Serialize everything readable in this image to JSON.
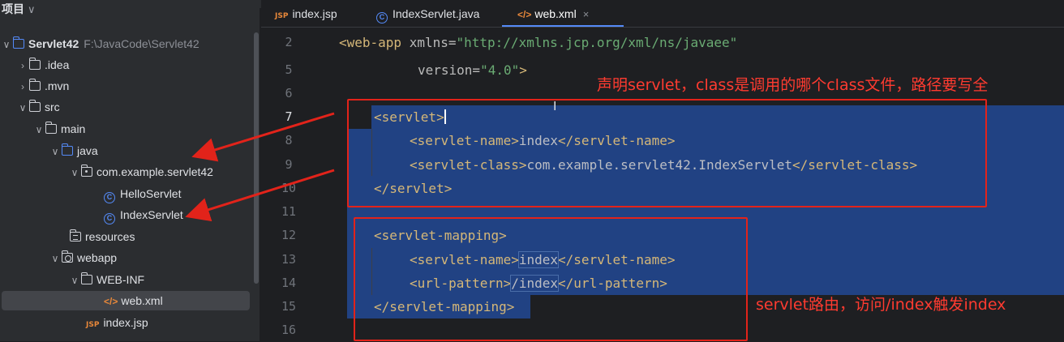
{
  "project_panel": {
    "title": "项目",
    "title_chevron": "∨",
    "tree": [
      {
        "label": "Servlet42",
        "path": "F:\\JavaCode\\Servlet42",
        "arrow": "∨",
        "icon": "module-folder-icon"
      },
      {
        "label": ".idea",
        "arrow": "›",
        "icon": "folder-icon"
      },
      {
        "label": ".mvn",
        "arrow": "›",
        "icon": "folder-icon"
      },
      {
        "label": "src",
        "arrow": "∨",
        "icon": "folder-icon"
      },
      {
        "label": "main",
        "arrow": "∨",
        "icon": "folder-icon"
      },
      {
        "label": "java",
        "arrow": "∨",
        "icon": "source-folder-icon"
      },
      {
        "label": "com.example.servlet42",
        "arrow": "∨",
        "icon": "package-icon"
      },
      {
        "label": "HelloServlet",
        "arrow": "",
        "icon": "class-icon"
      },
      {
        "label": "IndexServlet",
        "arrow": "",
        "icon": "class-icon"
      },
      {
        "label": "resources",
        "arrow": "",
        "icon": "resources-folder-icon"
      },
      {
        "label": "webapp",
        "arrow": "∨",
        "icon": "web-folder-icon"
      },
      {
        "label": "WEB-INF",
        "arrow": "∨",
        "icon": "folder-icon"
      },
      {
        "label": "web.xml",
        "arrow": "",
        "icon": "xml-file-icon",
        "selected": true
      },
      {
        "label": "index.jsp",
        "arrow": "",
        "icon": "jsp-file-icon"
      }
    ],
    "class_glyph": "C",
    "xml_glyph": "</>",
    "jsp_glyph": "JSP"
  },
  "tabs": [
    {
      "label": "index.jsp",
      "icon": "jsp-file-icon",
      "glyph": "JSP"
    },
    {
      "label": "IndexServlet.java",
      "icon": "class-icon",
      "glyph": "C"
    },
    {
      "label": "web.xml",
      "icon": "xml-file-icon",
      "glyph": "</>",
      "active": true,
      "close": "×"
    }
  ],
  "editor": {
    "line_numbers": [
      "2",
      "5",
      "6",
      "7",
      "8",
      "9",
      "10",
      "11",
      "12",
      "13",
      "14",
      "15",
      "16"
    ],
    "current_line": "7",
    "code": {
      "l2_open": "<web-app ",
      "l2_attr": "xmlns=",
      "l2_val": "\"http://xmlns.jcp.org/xml/ns/javaee\"",
      "l5_attr": "version=",
      "l5_val": "\"4.0\"",
      "l5_close": ">",
      "servlet_open": "<servlet>",
      "servlet_name_open": "<servlet-name>",
      "servlet_name_val": "index",
      "servlet_name_close": "</servlet-name>",
      "servlet_class_open": "<servlet-class>",
      "servlet_class_val": "com.example.servlet42.IndexServlet",
      "servlet_class_close": "</servlet-class>",
      "servlet_close": "</servlet>",
      "mapping_open": "<servlet-mapping>",
      "mapping_name_open": "<servlet-name>",
      "mapping_name_val": "index",
      "mapping_name_close": "</servlet-name>",
      "url_open": "<url-pattern>",
      "url_val": "/index",
      "url_close": "</url-pattern>",
      "mapping_close": "</servlet-mapping>"
    }
  },
  "annotations": {
    "note_servlet": "声明servlet，class是调用的哪个class文件，路径要写全",
    "note_mapping": "servlet路由，访问/index触发index",
    "color": "#e2231a"
  }
}
